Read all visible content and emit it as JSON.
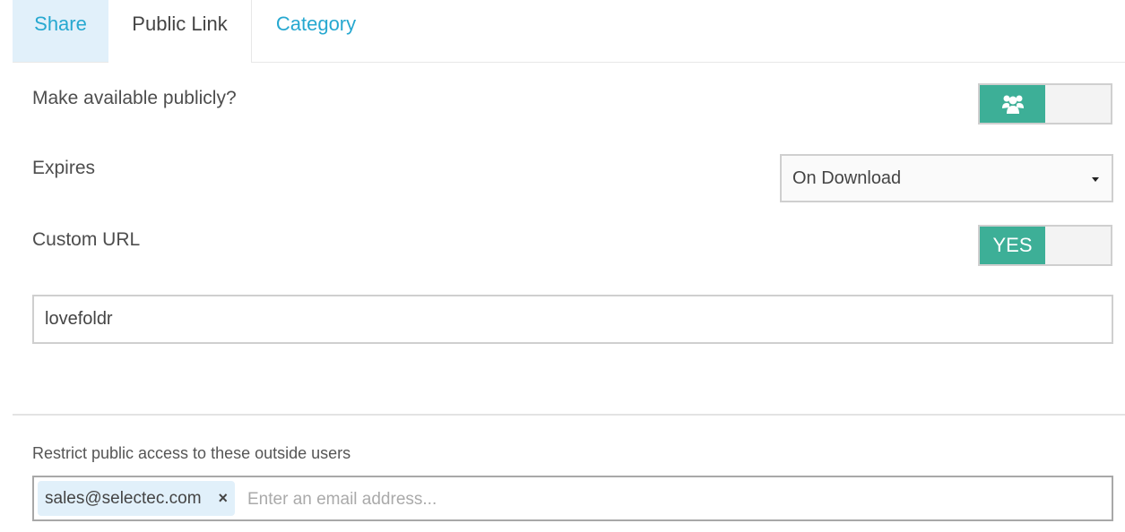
{
  "tabs": [
    {
      "label": "Share",
      "active": false
    },
    {
      "label": "Public Link",
      "active": true
    },
    {
      "label": "Category",
      "active": false
    }
  ],
  "public_link": {
    "make_public": {
      "label": "Make available publicly?",
      "toggle_icon": "users-icon",
      "state": "on"
    },
    "expires": {
      "label": "Expires",
      "selected": "On Download"
    },
    "custom_url": {
      "label": "Custom URL",
      "toggle_label": "YES",
      "state": "on",
      "value": "lovefoldr"
    },
    "restrict": {
      "label": "Restrict public access to these outside users",
      "emails": [
        "sales@selectec.com"
      ],
      "remove_glyph": "×",
      "placeholder": "Enter an email address..."
    }
  },
  "colors": {
    "accent_link": "#26a8d0",
    "toggle_on": "#3daf97",
    "active_tab_bg": "#e1f0fa"
  }
}
